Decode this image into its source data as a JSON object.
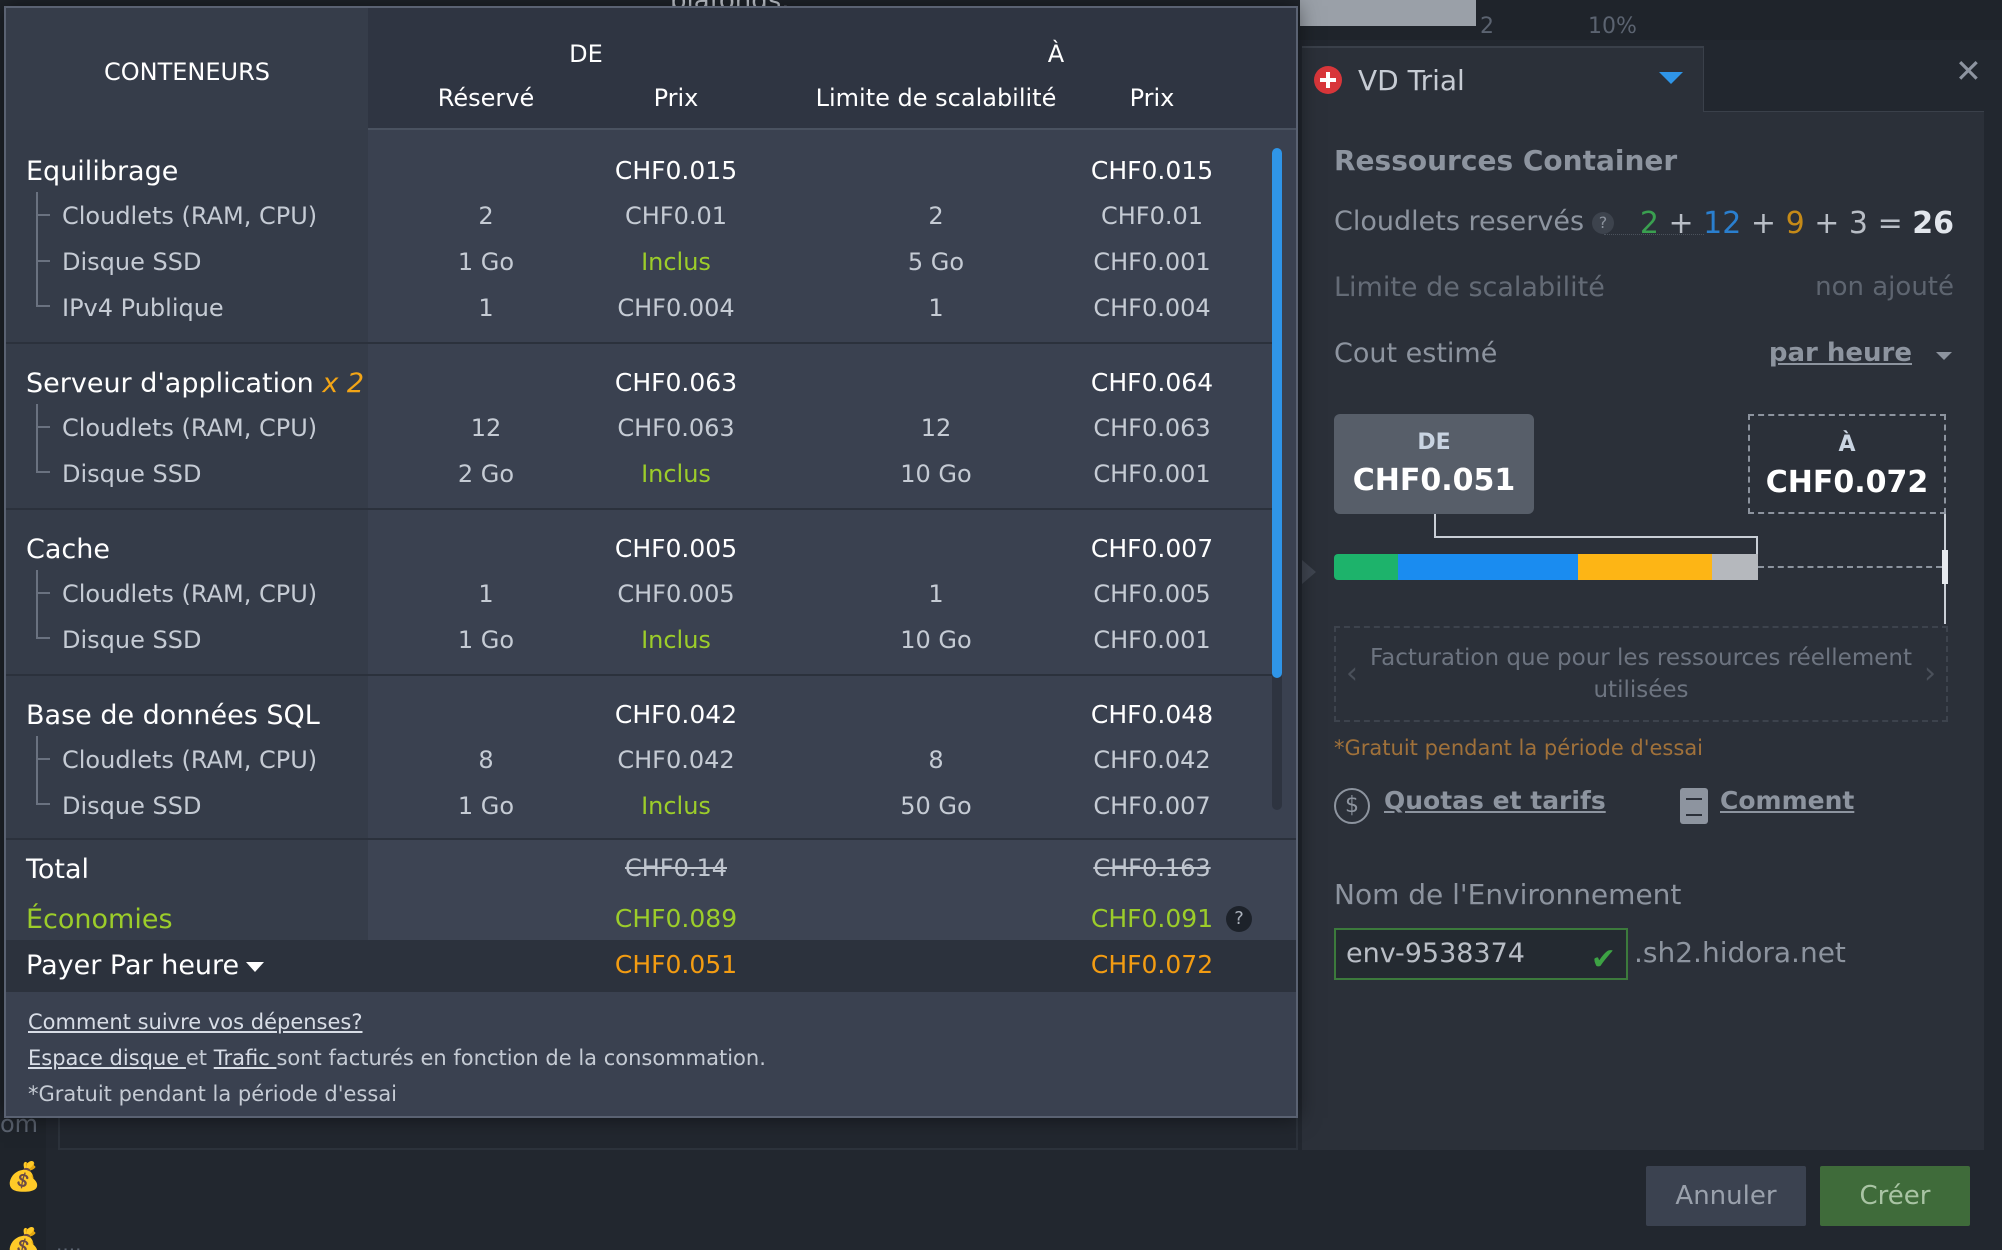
{
  "background": {
    "link_text": "plafonds.",
    "stat_1": "2",
    "stat_2": "10%",
    "side_text": "om",
    "bottom_text": "...."
  },
  "pricing": {
    "header": {
      "containers": "CONTENEURS",
      "from": "DE",
      "to": "À",
      "reserved": "Réservé",
      "price": "Prix",
      "scal_limit": "Limite de scalabilité",
      "price2": "Prix"
    },
    "groups": [
      {
        "title": "Equilibrage",
        "multiplier": "",
        "price_from": "CHF0.015",
        "price_to": "CHF0.015",
        "rows": [
          {
            "label": "Cloudlets (RAM, CPU)",
            "reserved": "2",
            "price_from": "CHF0.01",
            "limit": "2",
            "price_to": "CHF0.01"
          },
          {
            "label": "Disque SSD",
            "reserved": "1 Go",
            "price_from": "Inclus",
            "limit": "5 Go",
            "price_to": "CHF0.001"
          },
          {
            "label": "IPv4 Publique",
            "reserved": "1",
            "price_from": "CHF0.004",
            "limit": "1",
            "price_to": "CHF0.004"
          }
        ]
      },
      {
        "title": "Serveur d'application",
        "multiplier": "x 2",
        "price_from": "CHF0.063",
        "price_to": "CHF0.064",
        "rows": [
          {
            "label": "Cloudlets (RAM, CPU)",
            "reserved": "12",
            "price_from": "CHF0.063",
            "limit": "12",
            "price_to": "CHF0.063"
          },
          {
            "label": "Disque SSD",
            "reserved": "2 Go",
            "price_from": "Inclus",
            "limit": "10 Go",
            "price_to": "CHF0.001"
          }
        ]
      },
      {
        "title": "Cache",
        "multiplier": "",
        "price_from": "CHF0.005",
        "price_to": "CHF0.007",
        "rows": [
          {
            "label": "Cloudlets (RAM, CPU)",
            "reserved": "1",
            "price_from": "CHF0.005",
            "limit": "1",
            "price_to": "CHF0.005"
          },
          {
            "label": "Disque SSD",
            "reserved": "1 Go",
            "price_from": "Inclus",
            "limit": "10 Go",
            "price_to": "CHF0.001"
          }
        ]
      },
      {
        "title": "Base de données SQL",
        "multiplier": "",
        "price_from": "CHF0.042",
        "price_to": "CHF0.048",
        "rows": [
          {
            "label": "Cloudlets (RAM, CPU)",
            "reserved": "8",
            "price_from": "CHF0.042",
            "limit": "8",
            "price_to": "CHF0.042"
          },
          {
            "label": "Disque SSD",
            "reserved": "1 Go",
            "price_from": "Inclus",
            "limit": "50 Go",
            "price_to": "CHF0.007"
          }
        ]
      }
    ],
    "total": {
      "label": "Total",
      "from": "CHF0.14",
      "to": "CHF0.163"
    },
    "savings": {
      "label": "Économies",
      "from": "CHF0.089",
      "to": "CHF0.091",
      "help": "?"
    },
    "pay": {
      "label": "Payer",
      "period": "Par heure",
      "from": "CHF0.051",
      "to": "CHF0.072"
    },
    "footer": {
      "track_link": "Comment suivre vos dépenses?",
      "disk_link": "Espace disque ",
      "and": "et ",
      "traffic_link": "Trafic ",
      "billed_text": "sont facturés en fonction de la consommation.",
      "free_note": "*Gratuit pendant la période d'essai"
    }
  },
  "wizard": {
    "tab_title": "VD Trial",
    "section_title": "Ressources Container",
    "reserved_label": "Cloudlets reservés",
    "reserved_help": "?",
    "cloudlets": {
      "a": "2",
      "b": "12",
      "c": "9",
      "d": "3",
      "plus": "+",
      "eq": "=",
      "total": "26"
    },
    "scal_label": "Limite de scalabilité",
    "scal_value": "non ajouté",
    "cost_label": "Cout estimé",
    "cost_period": "par heure",
    "from_label": "DE",
    "from_value": "CHF0.051",
    "to_label": "À",
    "to_value": "CHF0.072",
    "bar_colors": {
      "green": "#1db36b",
      "blue": "#1a8cf0",
      "orange": "#fdb515",
      "gray": "#b5b8bd"
    },
    "billing_note": "Facturation que pour les ressources réellement utilisées",
    "free_note": "*Gratuit pendant la période d'essai",
    "quotas_link": "Quotas et tarifs",
    "how_link": "Comment",
    "env_label": "Nom de l'Environnement",
    "env_value": "env-9538374",
    "env_domain": ".sh2.hidora.net",
    "cancel_label": "Annuler",
    "create_label": "Créer"
  }
}
